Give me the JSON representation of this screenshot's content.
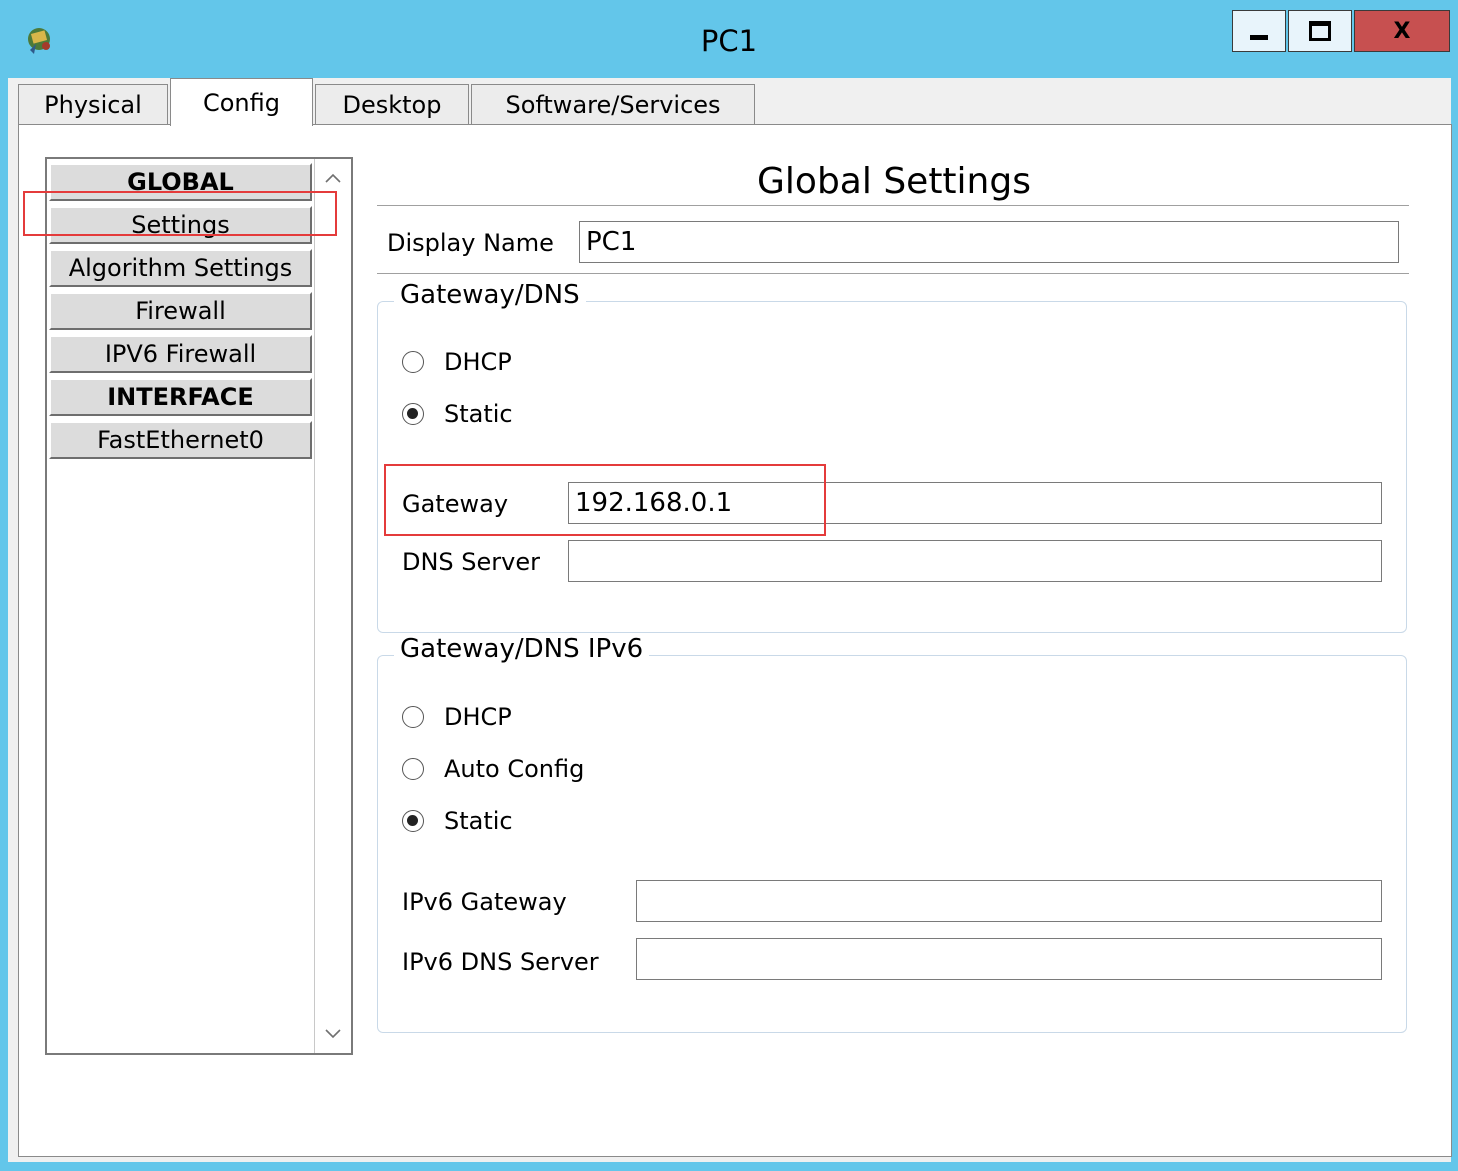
{
  "window": {
    "title": "PC1",
    "app_icon": "packet-tracer-pc-icon",
    "controls": {
      "minimize_icon": "minimize-icon",
      "maximize_icon": "maximize-icon",
      "close_label": "X"
    }
  },
  "tabs": [
    {
      "label": "Physical",
      "active": false
    },
    {
      "label": "Config",
      "active": true
    },
    {
      "label": "Desktop",
      "active": false
    },
    {
      "label": "Software/Services",
      "active": false
    }
  ],
  "nav": {
    "items": [
      {
        "label": "GLOBAL",
        "header": true
      },
      {
        "label": "Settings",
        "header": false,
        "highlighted": true
      },
      {
        "label": "Algorithm Settings",
        "header": false
      },
      {
        "label": "Firewall",
        "header": false
      },
      {
        "label": "IPV6 Firewall",
        "header": false
      },
      {
        "label": "INTERFACE",
        "header": true
      },
      {
        "label": "FastEthernet0",
        "header": false
      }
    ],
    "scroll_up_icon": "chevron-up-icon",
    "scroll_down_icon": "chevron-down-icon"
  },
  "settings": {
    "title": "Global Settings",
    "display_name_label": "Display Name",
    "display_name_value": "PC1",
    "ipv4": {
      "legend": "Gateway/DNS",
      "radios": [
        {
          "label": "DHCP",
          "checked": false
        },
        {
          "label": "Static",
          "checked": true
        }
      ],
      "gateway_label": "Gateway",
      "gateway_value": "192.168.0.1",
      "dns_label": "DNS Server",
      "dns_value": ""
    },
    "ipv6": {
      "legend": "Gateway/DNS IPv6",
      "radios": [
        {
          "label": "DHCP",
          "checked": false
        },
        {
          "label": "Auto Config",
          "checked": false
        },
        {
          "label": "Static",
          "checked": true
        }
      ],
      "gateway_label": "IPv6 Gateway",
      "gateway_value": "",
      "dns_label": "IPv6 DNS Server",
      "dns_value": ""
    }
  },
  "colors": {
    "titlebar": "#63c6ea",
    "close_button": "#c75050",
    "highlight_box": "#e43b3b"
  }
}
